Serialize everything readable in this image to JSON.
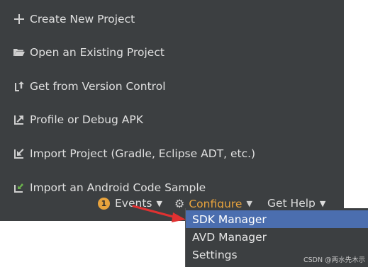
{
  "actions": [
    {
      "label": "Create New Project",
      "icon": "plus-icon"
    },
    {
      "label": "Open an Existing Project",
      "icon": "folder-open-icon"
    },
    {
      "label": "Get from Version Control",
      "icon": "vcs-checkout-icon"
    },
    {
      "label": "Profile or Debug APK",
      "icon": "debug-apk-icon"
    },
    {
      "label": "Import Project (Gradle, Eclipse ADT, etc.)",
      "icon": "import-project-icon"
    },
    {
      "label": "Import an Android Code Sample",
      "icon": "import-sample-icon"
    }
  ],
  "bottom": {
    "events_badge": "1",
    "events_label": "Events",
    "configure_label": "Configure",
    "get_help_label": "Get Help"
  },
  "configure_menu": {
    "items": [
      {
        "label": "SDK Manager",
        "selected": true
      },
      {
        "label": "AVD Manager",
        "selected": false
      },
      {
        "label": "Settings",
        "selected": false
      }
    ]
  },
  "watermark": "CSDN @两水先木示",
  "colors": {
    "panel_bg": "#3c3f41",
    "text": "#e0e0e0",
    "accent_orange": "#e8a33d",
    "selection_blue": "#4b6eaf",
    "annotation_red": "#e03131"
  }
}
